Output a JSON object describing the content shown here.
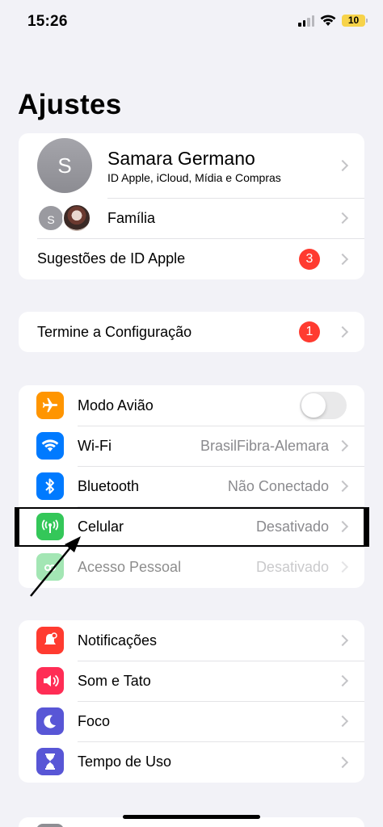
{
  "status_bar": {
    "time": "15:26",
    "battery_level": "10",
    "battery_color": "#f7d34a"
  },
  "title": "Ajustes",
  "account": {
    "avatar_initial": "S",
    "name": "Samara Germano",
    "subtitle": "ID Apple, iCloud, Mídia e Compras",
    "family_avatar_initial": "S",
    "family_label": "Família",
    "suggestions_label": "Sugestões de ID Apple",
    "suggestions_badge": "3"
  },
  "setup": {
    "label": "Termine a Configuração",
    "badge": "1"
  },
  "connectivity": [
    {
      "icon": "airplane-icon",
      "color": "#ff9500",
      "label": "Modo Avião",
      "toggle_on": false
    },
    {
      "icon": "wifi-icon",
      "color": "#007aff",
      "label": "Wi-Fi",
      "value": "BrasilFibra-Alemara"
    },
    {
      "icon": "bluetooth-icon",
      "color": "#007aff",
      "label": "Bluetooth",
      "value": "Não Conectado"
    },
    {
      "icon": "antenna-icon",
      "color": "#34c759",
      "label": "Celular",
      "value": "Desativado"
    },
    {
      "icon": "hotspot-icon",
      "color": "#34c759",
      "label": "Acesso Pessoal",
      "value": "Desativado"
    }
  ],
  "notifications_group": [
    {
      "icon": "bell-icon",
      "color": "#ff3b30",
      "label": "Notificações"
    },
    {
      "icon": "speaker-icon",
      "color": "#ff2d55",
      "label": "Som e Tato"
    },
    {
      "icon": "moon-icon",
      "color": "#5856d6",
      "label": "Foco"
    },
    {
      "icon": "hourglass-icon",
      "color": "#5856d6",
      "label": "Tempo de Uso"
    }
  ]
}
